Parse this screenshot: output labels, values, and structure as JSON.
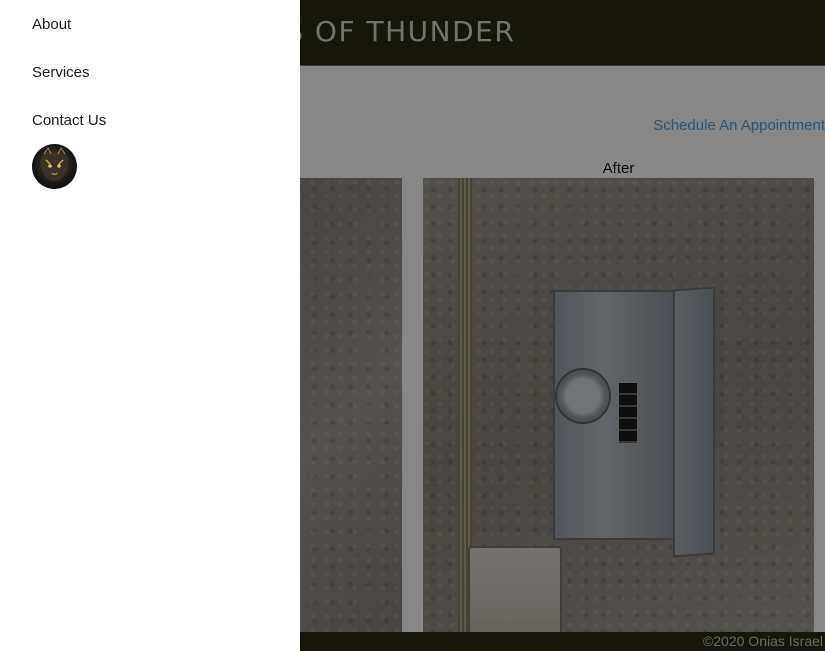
{
  "site": {
    "title": "SONS OF THUNDER",
    "schedule_link": "Schedule An Appointment",
    "after_label": "After",
    "copyright": "©2020 Onias Israel"
  },
  "drawer": {
    "items": [
      {
        "label": "About"
      },
      {
        "label": "Services"
      },
      {
        "label": "Contact Us"
      }
    ],
    "avatar": {
      "icon": "lion-logo-icon"
    }
  },
  "colors": {
    "header_bg": "#2b2a13",
    "link": "#4ea3e6",
    "drawer_bg": "#ffffff"
  }
}
